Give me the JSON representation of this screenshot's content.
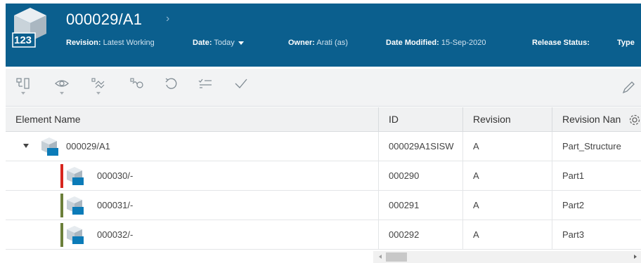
{
  "header": {
    "icon": "part-cube-icon",
    "icon_badge": "123",
    "title": "000029/A1",
    "meta": [
      {
        "label": "Revision:",
        "value": "Latest Working"
      },
      {
        "label": "Date:",
        "value": "Today"
      },
      {
        "label": "Owner:",
        "value": "Arati (as)"
      },
      {
        "label": "Date Modified:",
        "value": "15-Sep-2020"
      },
      {
        "label": "Release Status:",
        "value": ""
      },
      {
        "label": "Type",
        "value": ""
      }
    ],
    "colors": {
      "background": "#0b5f8e"
    }
  },
  "toolbar": {
    "buttons": [
      "structure-icon",
      "eye-icon",
      "compare-icon",
      "link-icon",
      "undo-icon",
      "checklist-icon",
      "check-icon"
    ],
    "right": "pencil-icon"
  },
  "table": {
    "columns": [
      "Element Name",
      "ID",
      "Revision",
      "Revision Nan"
    ],
    "rows": [
      {
        "name": "000029/A1",
        "id": "000029A1SISW",
        "revision": "A",
        "revision_name": "Part_Structure",
        "status_color": "",
        "expanded": true
      },
      {
        "name": "000030/-",
        "id": "000290",
        "revision": "A",
        "revision_name": "Part1",
        "status_color": "#d7261e"
      },
      {
        "name": "000031/-",
        "id": "000291",
        "revision": "A",
        "revision_name": "Part2",
        "status_color": "#6b7f3a"
      },
      {
        "name": "000032/-",
        "id": "000292",
        "revision": "A",
        "revision_name": "Part3",
        "status_color": "#6b7f3a"
      }
    ]
  }
}
